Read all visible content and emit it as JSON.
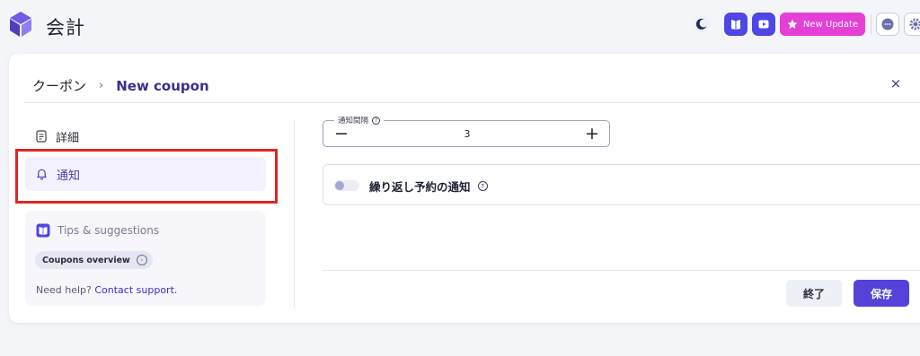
{
  "app": {
    "title": "会計"
  },
  "topbar": {
    "update_label": "New Update"
  },
  "breadcrumb": {
    "root": "クーポン",
    "separator": "›",
    "current": "New coupon"
  },
  "close_label": "×",
  "sidebar": {
    "items": [
      {
        "label": "詳細",
        "icon": "document-icon"
      },
      {
        "label": "通知",
        "icon": "bell-icon"
      }
    ]
  },
  "tips": {
    "title": "Tips & suggestions",
    "chip": "Coupons overview",
    "help_prefix": "Need help?",
    "help_link": "Contact support."
  },
  "form": {
    "interval_label": "通知間隔",
    "interval_value": "3",
    "minus": "−",
    "plus": "+",
    "repeat_label": "繰り返し予約の通知",
    "repeat_enabled": false
  },
  "actions": {
    "end_label": "終了",
    "save_label": "保存"
  },
  "colors": {
    "accent": "#5542d9",
    "update": "#e63fd7",
    "highlight": "#e02424"
  }
}
